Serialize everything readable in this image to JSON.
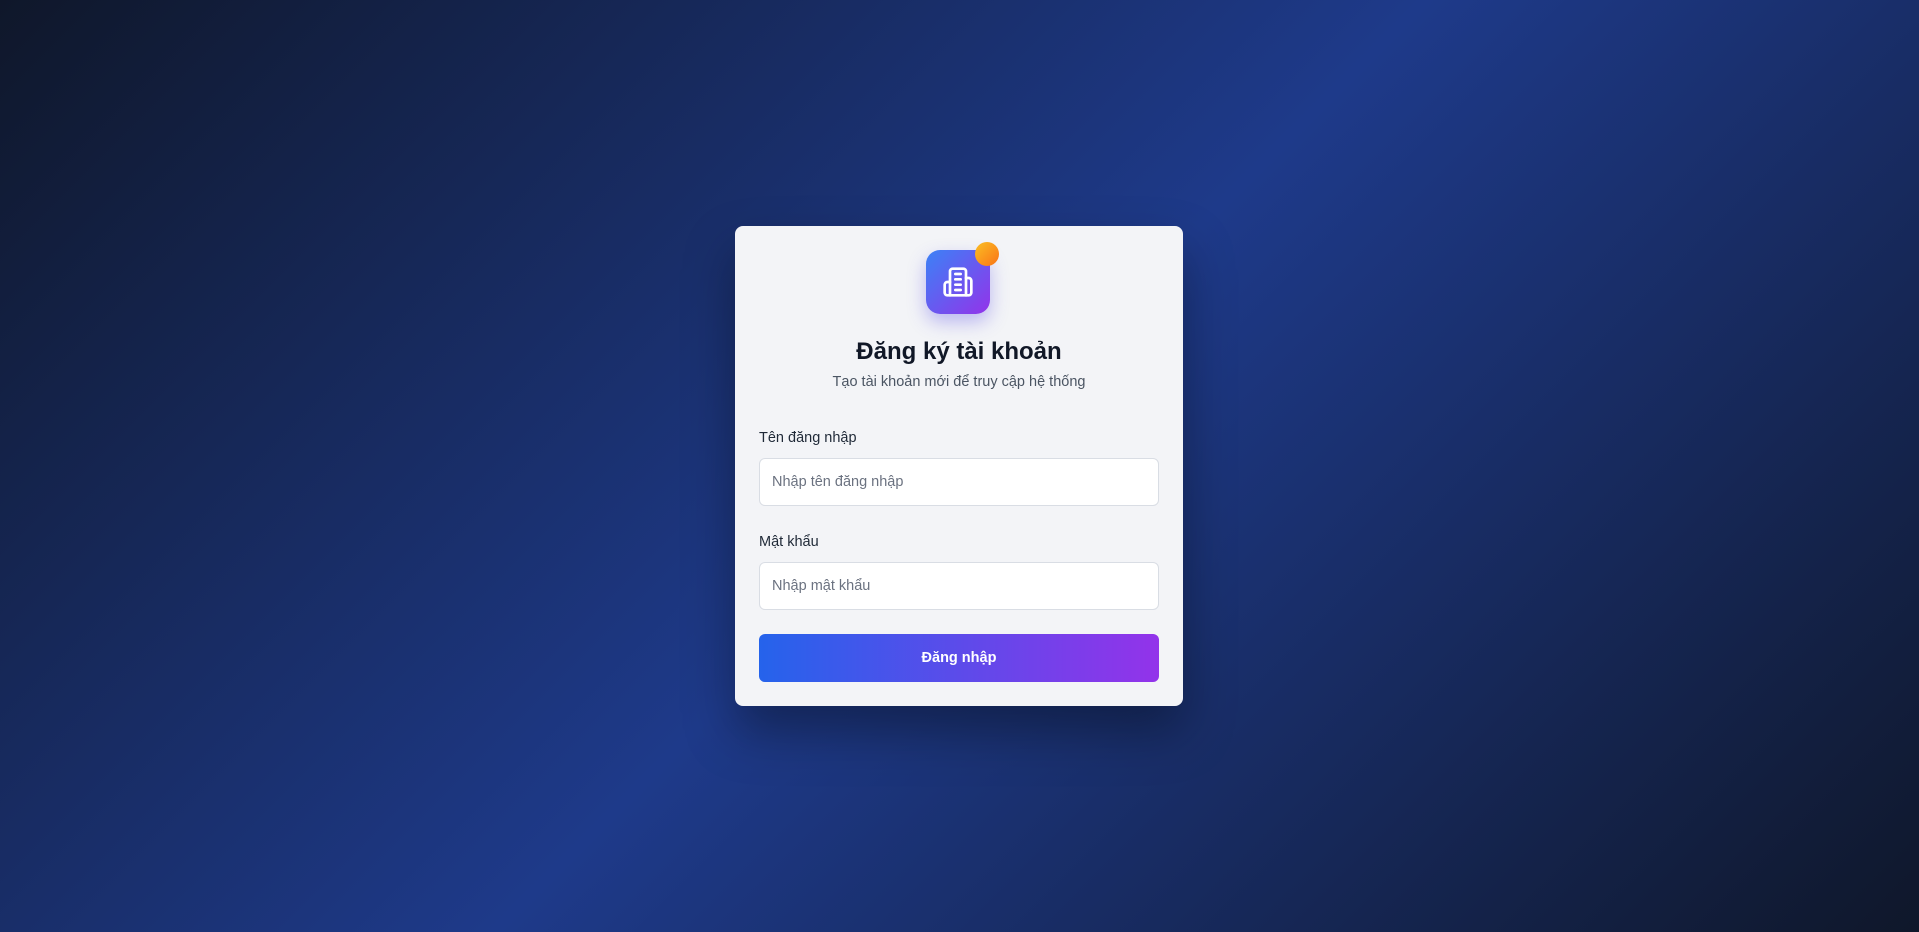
{
  "header": {
    "title": "Đăng ký tài khoản",
    "subtitle": "Tạo tài khoản mới để truy cập hệ thống",
    "logo_icon": "building-icon",
    "accent_colors": {
      "logo_start": "#3b82f6",
      "logo_end": "#9333ea",
      "badge": "#f59e0b"
    }
  },
  "form": {
    "username": {
      "label": "Tên đăng nhập",
      "placeholder": "Nhập tên đăng nhập",
      "value": ""
    },
    "password": {
      "label": "Mật khẩu",
      "placeholder": "Nhập mật khẩu",
      "value": ""
    },
    "submit_label": "Đăng nhập"
  }
}
